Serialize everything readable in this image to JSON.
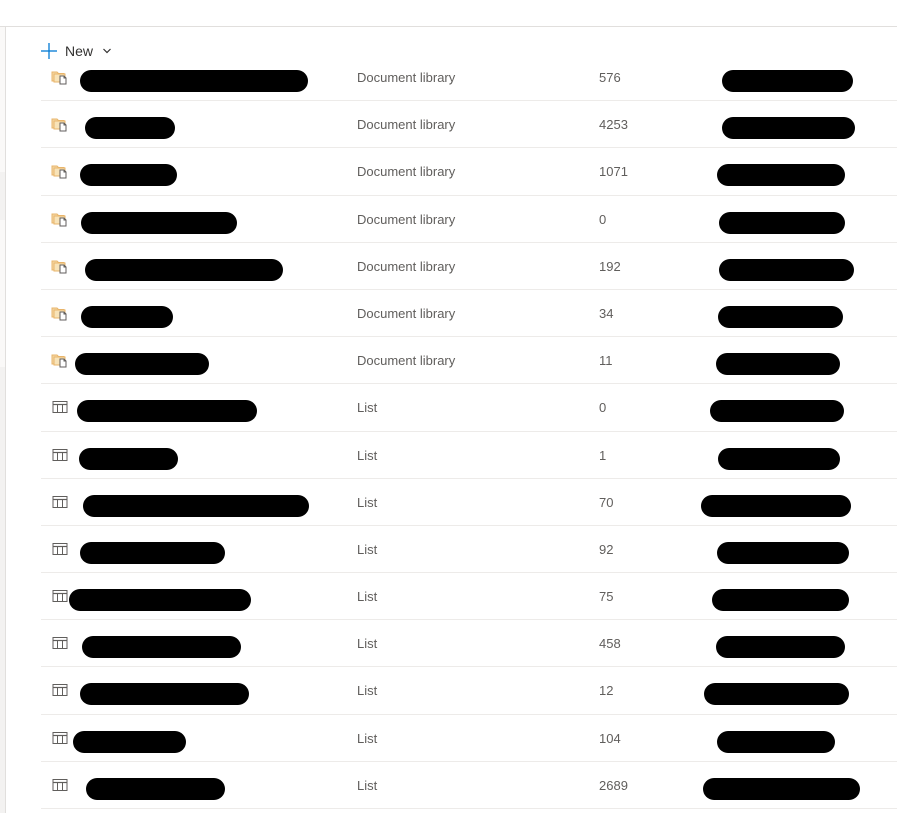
{
  "command_bar": {
    "new_label": "New"
  },
  "colors": {
    "accent": "#0078d4",
    "folder": "#e8b46a",
    "text": "#323130",
    "secondary_text": "#605e5c"
  },
  "items": [
    {
      "icon": "document-library-icon",
      "type": "Document library",
      "item_count": "576"
    },
    {
      "icon": "document-library-icon",
      "type": "Document library",
      "item_count": "4253"
    },
    {
      "icon": "document-library-icon",
      "type": "Document library",
      "item_count": "1071"
    },
    {
      "icon": "document-library-icon",
      "type": "Document library",
      "item_count": "0"
    },
    {
      "icon": "document-library-icon",
      "type": "Document library",
      "item_count": "192"
    },
    {
      "icon": "document-library-icon",
      "type": "Document library",
      "item_count": "34"
    },
    {
      "icon": "document-library-icon",
      "type": "Document library",
      "item_count": "11"
    },
    {
      "icon": "list-icon",
      "type": "List",
      "item_count": "0"
    },
    {
      "icon": "list-icon",
      "type": "List",
      "item_count": "1"
    },
    {
      "icon": "list-icon",
      "type": "List",
      "item_count": "70"
    },
    {
      "icon": "list-icon",
      "type": "List",
      "item_count": "92"
    },
    {
      "icon": "list-icon",
      "type": "List",
      "item_count": "75"
    },
    {
      "icon": "list-icon",
      "type": "List",
      "item_count": "458"
    },
    {
      "icon": "list-icon",
      "type": "List",
      "item_count": "12"
    },
    {
      "icon": "list-icon",
      "type": "List",
      "item_count": "104"
    },
    {
      "icon": "list-icon",
      "type": "List",
      "item_count": "2689"
    }
  ]
}
